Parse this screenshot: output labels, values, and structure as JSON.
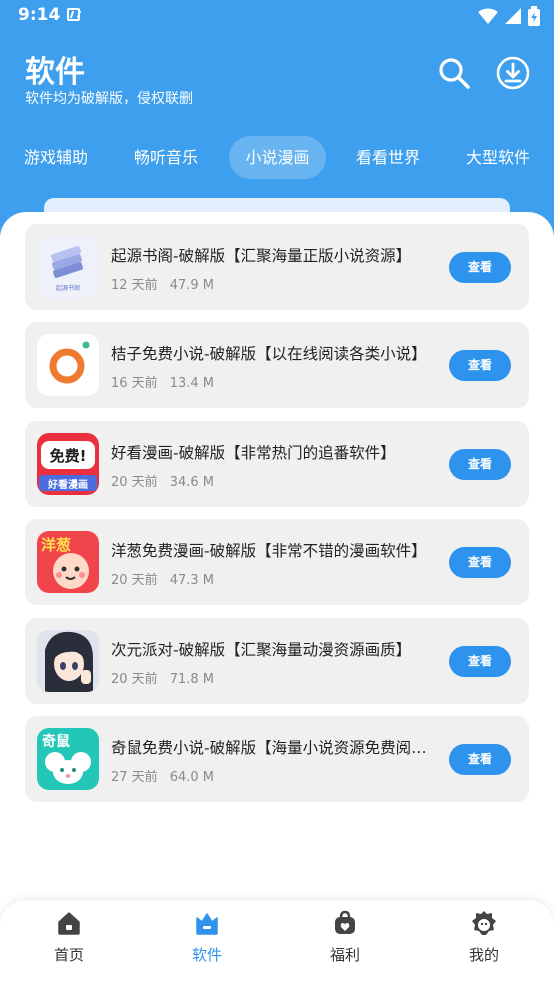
{
  "status_bar": {
    "time": "9:14"
  },
  "header": {
    "title": "软件",
    "subtitle": "软件均为破解版，侵权联删"
  },
  "tabs": [
    {
      "label": "游戏辅助",
      "active": false
    },
    {
      "label": "畅听音乐",
      "active": false
    },
    {
      "label": "小说漫画",
      "active": true
    },
    {
      "label": "看看世界",
      "active": false
    },
    {
      "label": "大型软件",
      "active": false
    }
  ],
  "apps": [
    {
      "name": "起源书阁-破解版【汇聚海量正版小说资源】",
      "time": "12 天前",
      "size": "47.9 M",
      "icon": "book-stack-icon",
      "icon_caption": "起源书阁",
      "button": "查看"
    },
    {
      "name": "桔子免费小说-破解版【以在线阅读各类小说】",
      "time": "16 天前",
      "size": "13.4 M",
      "icon": "orange-ring-icon",
      "button": "查看"
    },
    {
      "name": "好看漫画-破解版【非常热门的追番软件】",
      "time": "20 天前",
      "size": "34.6 M",
      "icon": "free-comic-icon",
      "icon_text_top": "免费!",
      "icon_text_bottom": "好看漫画",
      "button": "查看"
    },
    {
      "name": "洋葱免费漫画-破解版【非常不错的漫画软件】",
      "time": "20 天前",
      "size": "47.3 M",
      "icon": "onion-comic-icon",
      "icon_text_top": "洋葱",
      "button": "查看"
    },
    {
      "name": "次元派对-破解版【汇聚海量动漫资源画质】",
      "time": "20 天前",
      "size": "71.8 M",
      "icon": "anime-girl-icon",
      "button": "查看"
    },
    {
      "name": "奇鼠免费小说-破解版【海量小说资源免费阅读】",
      "time": "27 天前",
      "size": "64.0 M",
      "icon": "mouse-novel-icon",
      "icon_text_top": "奇鼠",
      "button": "查看"
    }
  ],
  "bottom_nav": [
    {
      "label": "首页",
      "active": false,
      "icon": "home-icon"
    },
    {
      "label": "软件",
      "active": true,
      "icon": "software-icon"
    },
    {
      "label": "福利",
      "active": false,
      "icon": "gift-bag-icon"
    },
    {
      "label": "我的",
      "active": false,
      "icon": "profile-icon"
    }
  ],
  "colors": {
    "primary": "#3d9fee",
    "button": "#2e93ec",
    "card": "#f0f0f0"
  }
}
